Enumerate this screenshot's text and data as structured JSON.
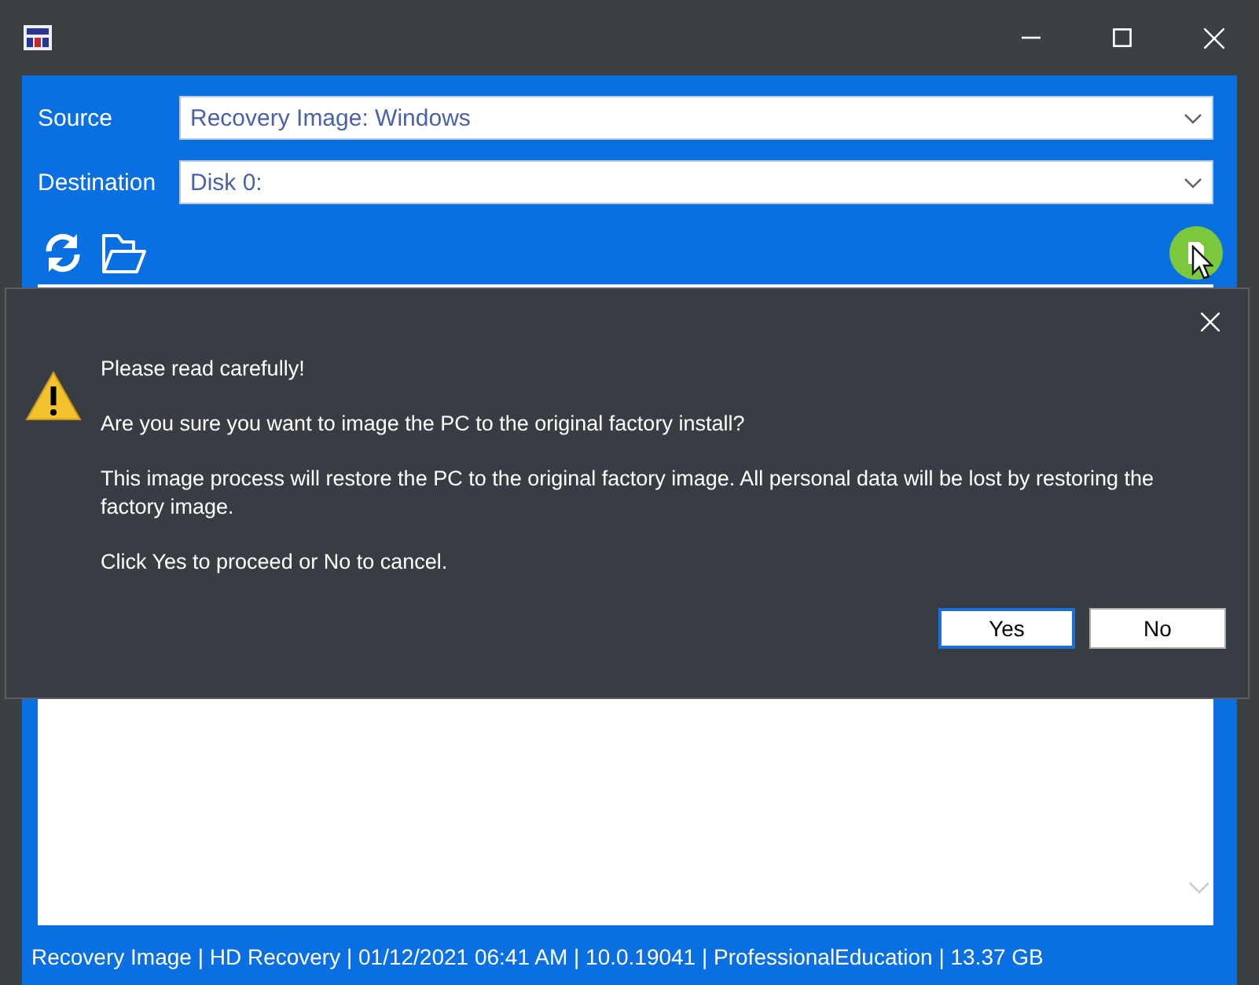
{
  "fields": [
    {
      "label": "Source",
      "value": "Recovery Image: Windows"
    },
    {
      "label": "Destination",
      "value": "Disk 0:"
    }
  ],
  "status_bar": "Recovery Image | HD Recovery | 01/12/2021 06:41 AM | 10.0.19041 | ProfessionalEducation | 13.37 GB",
  "dialog": {
    "heading": "Please read carefully!",
    "paragraphs": [
      "Are you sure you want to image the PC to the original factory install?",
      "This image process will restore the PC to the original factory image. All personal data will be lost by restoring the factory image.",
      "Click Yes to proceed or No to cancel."
    ],
    "buttons": [
      {
        "label": "Yes",
        "selected": true
      },
      {
        "label": "No",
        "selected": false
      }
    ]
  }
}
